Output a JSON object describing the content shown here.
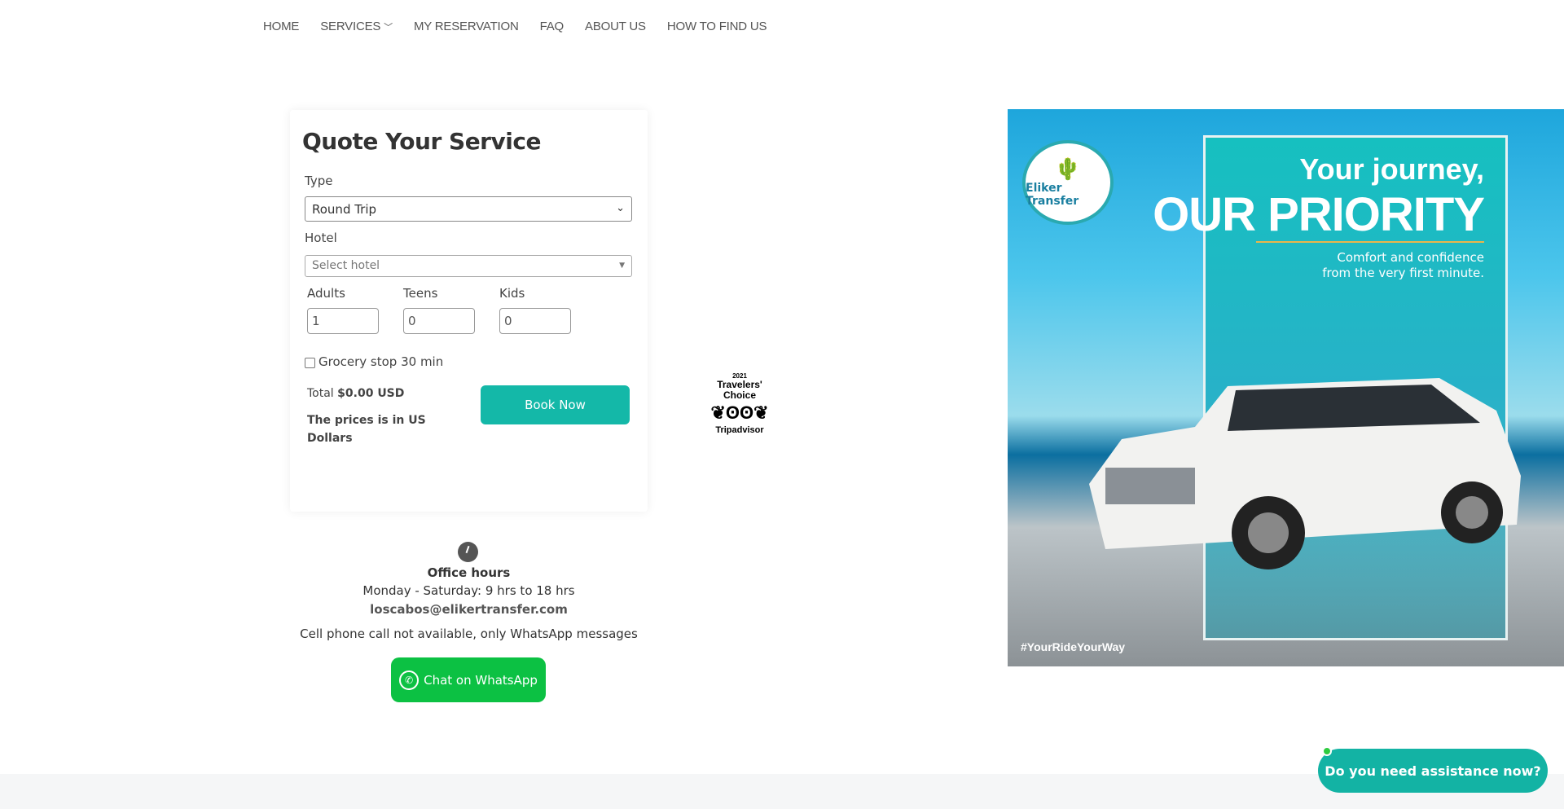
{
  "nav": {
    "items": [
      "HOME",
      "SERVICES",
      "MY RESERVATION",
      "FAQ",
      "ABOUT US",
      "HOW TO FIND US"
    ]
  },
  "quote": {
    "title": "Quote Your Service",
    "type_label": "Type",
    "type_value": "Round Trip",
    "hotel_label": "Hotel",
    "hotel_placeholder": "Select hotel",
    "adults_label": "Adults",
    "adults_value": "1",
    "teens_label": "Teens",
    "teens_value": "0",
    "kids_label": "Kids",
    "kids_value": "0",
    "grocery_label": "Grocery stop 30 min",
    "grocery_checked": false,
    "total_label": "Total",
    "total_value": "$0.00 USD",
    "currency_note": "The prices is in US Dollars",
    "book_label": "Book Now"
  },
  "badge": {
    "year": "2021",
    "line1": "Travelers'",
    "line2": "Choice",
    "brand": "Tripadvisor"
  },
  "office": {
    "title": "Office hours",
    "hours": "Monday - Saturday: 9 hrs to 18 hrs",
    "email": "loscabos@elikertransfer.com",
    "note": "Cell phone call not available, only WhatsApp messages",
    "whatsapp_label": "Chat on WhatsApp"
  },
  "hero": {
    "logo": "Eliker Transfer",
    "line1": "Your journey,",
    "line2": "OUR PRIORITY",
    "line3": "Comfort and confidence",
    "line4": "from the very first minute.",
    "hashtag": "#YourRideYourWay"
  },
  "assist": {
    "label": "Do you need assistance now?"
  },
  "colors": {
    "accent": "#14b8a8",
    "whatsapp": "#0cc143"
  }
}
